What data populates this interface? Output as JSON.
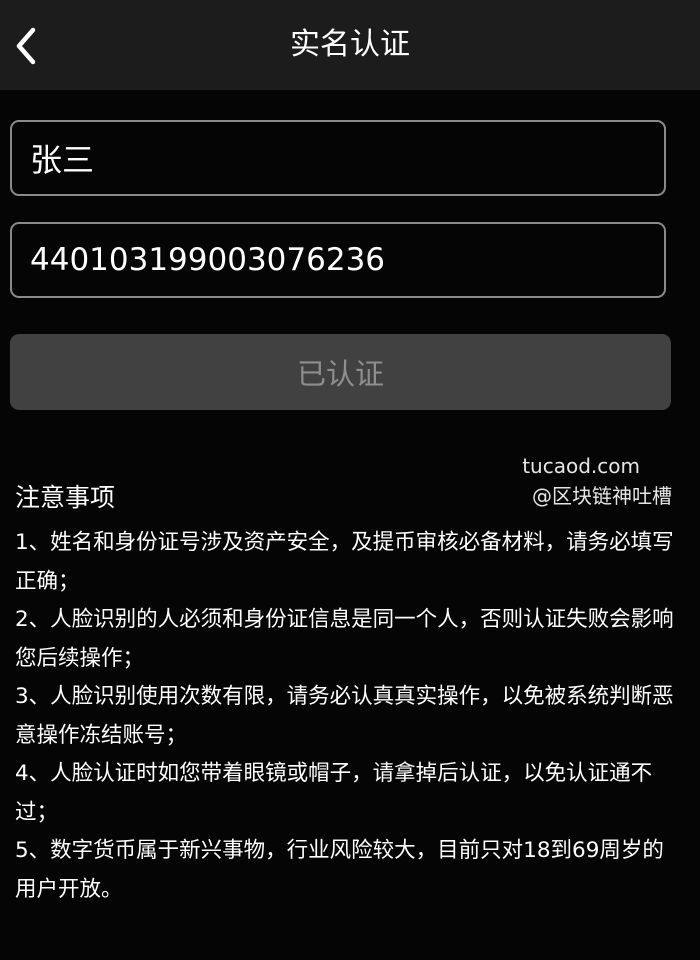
{
  "header": {
    "title": "实名认证",
    "back_icon": "chevron-left-icon"
  },
  "form": {
    "name_value": "张三",
    "id_number_value": "440103199003076236",
    "submit_label": "已认证"
  },
  "watermark": {
    "site": "tucaod.com",
    "handle": "@区块链神吐槽"
  },
  "notes": {
    "title": "注意事项",
    "items": [
      "1、姓名和身份证号涉及资产安全，及提币审核必备材料，请务必填写正确；",
      "2、人脸识别的人必须和身份证信息是同一个人，否则认证失败会影响您后续操作；",
      "3、人脸识别使用次数有限，请务必认真真实操作，以免被系统判断恶意操作冻结账号；",
      "4、人脸认证时如您带着眼镜或帽子，请拿掉后认证，以免认证通不过；",
      "5、数字货币属于新兴事物，行业风险较大，目前只对18到69周岁的用户开放。"
    ]
  },
  "colors": {
    "background": "#050505",
    "header": "#1c1c1c",
    "field_border": "#8a8a8a",
    "button_bg": "#414141",
    "button_text": "#8e8e8e"
  }
}
